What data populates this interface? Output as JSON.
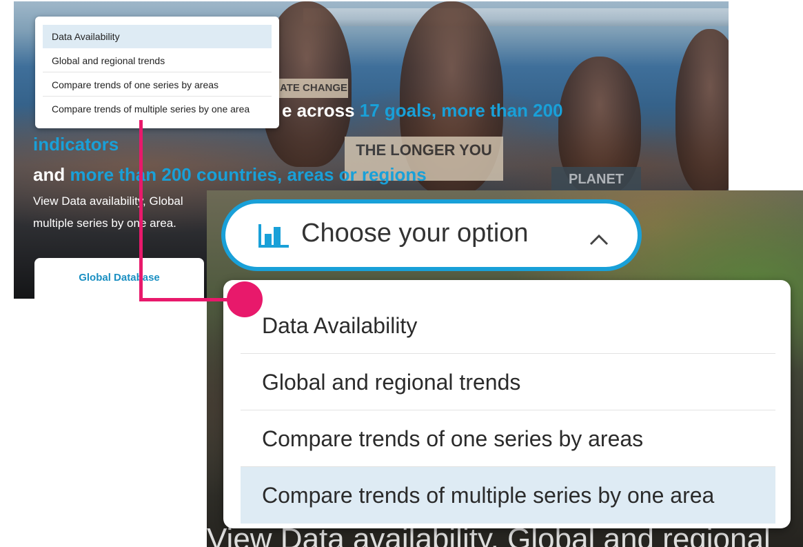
{
  "dropdown": {
    "placeholder": "Choose your option",
    "options": [
      "Data Availability",
      "Global and regional trends",
      "Compare trends of one series by areas",
      "Compare trends of multiple series by one area"
    ],
    "selected_index": 3,
    "highlight_color": "#deebf4",
    "border_color": "#19a0d8"
  },
  "hero": {
    "line1_white": "e across",
    "line1_blue": "17 goals, more than 200",
    "line2_blue": "indicators",
    "line3_white": "and",
    "line3_blue": "more than 200 countries, areas or regions",
    "sub1": "View Data availability, Global",
    "sub2": "multiple series by one area.",
    "tab_label": "Global Database",
    "signs": [
      "ATE CHANGE",
      "THE LONGER YOU",
      "PLANET"
    ]
  },
  "zoom": {
    "background_text": "View Data availability, Global and regional"
  },
  "colors": {
    "accent_blue": "#19a0d8",
    "connector": "#e8196b"
  },
  "icons": {
    "chart": "bar-chart-icon",
    "chevron": "chevron-up-icon"
  }
}
